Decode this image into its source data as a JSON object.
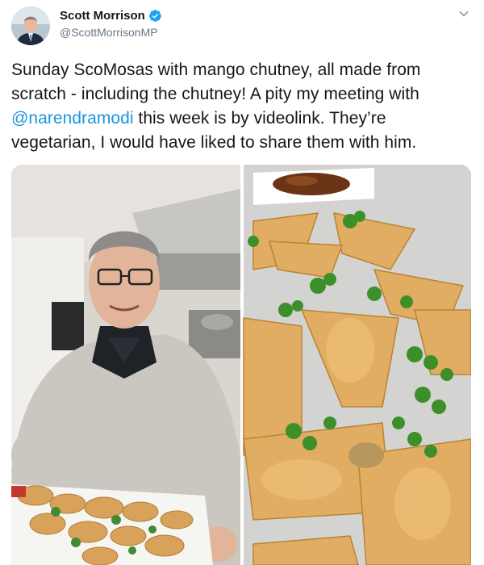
{
  "user": {
    "display_name": "Scott Morrison",
    "handle": "@ScottMorrisonMP",
    "avatar_icon": "profile-avatar",
    "verified_icon": "verified-badge-icon"
  },
  "menu": {
    "icon": "chevron-down-icon"
  },
  "tweet": {
    "text_before": "Sunday ScoMosas with mango chutney, all made from scratch - including the chutney! A pity my meeting with ",
    "mention": "@narendramodi",
    "text_after": " this week is by videolink. They’re vegetarian, I would have liked to share them with him."
  },
  "media": {
    "left_photo": "man-holding-tray-of-samosas-photo",
    "right_photo": "plate-of-samosas-with-coriander-and-chutney-photo"
  },
  "colors": {
    "link": "#1b95e0",
    "secondary_text": "#657786",
    "primary_text": "#14171a",
    "verified": "#1da1f2"
  }
}
